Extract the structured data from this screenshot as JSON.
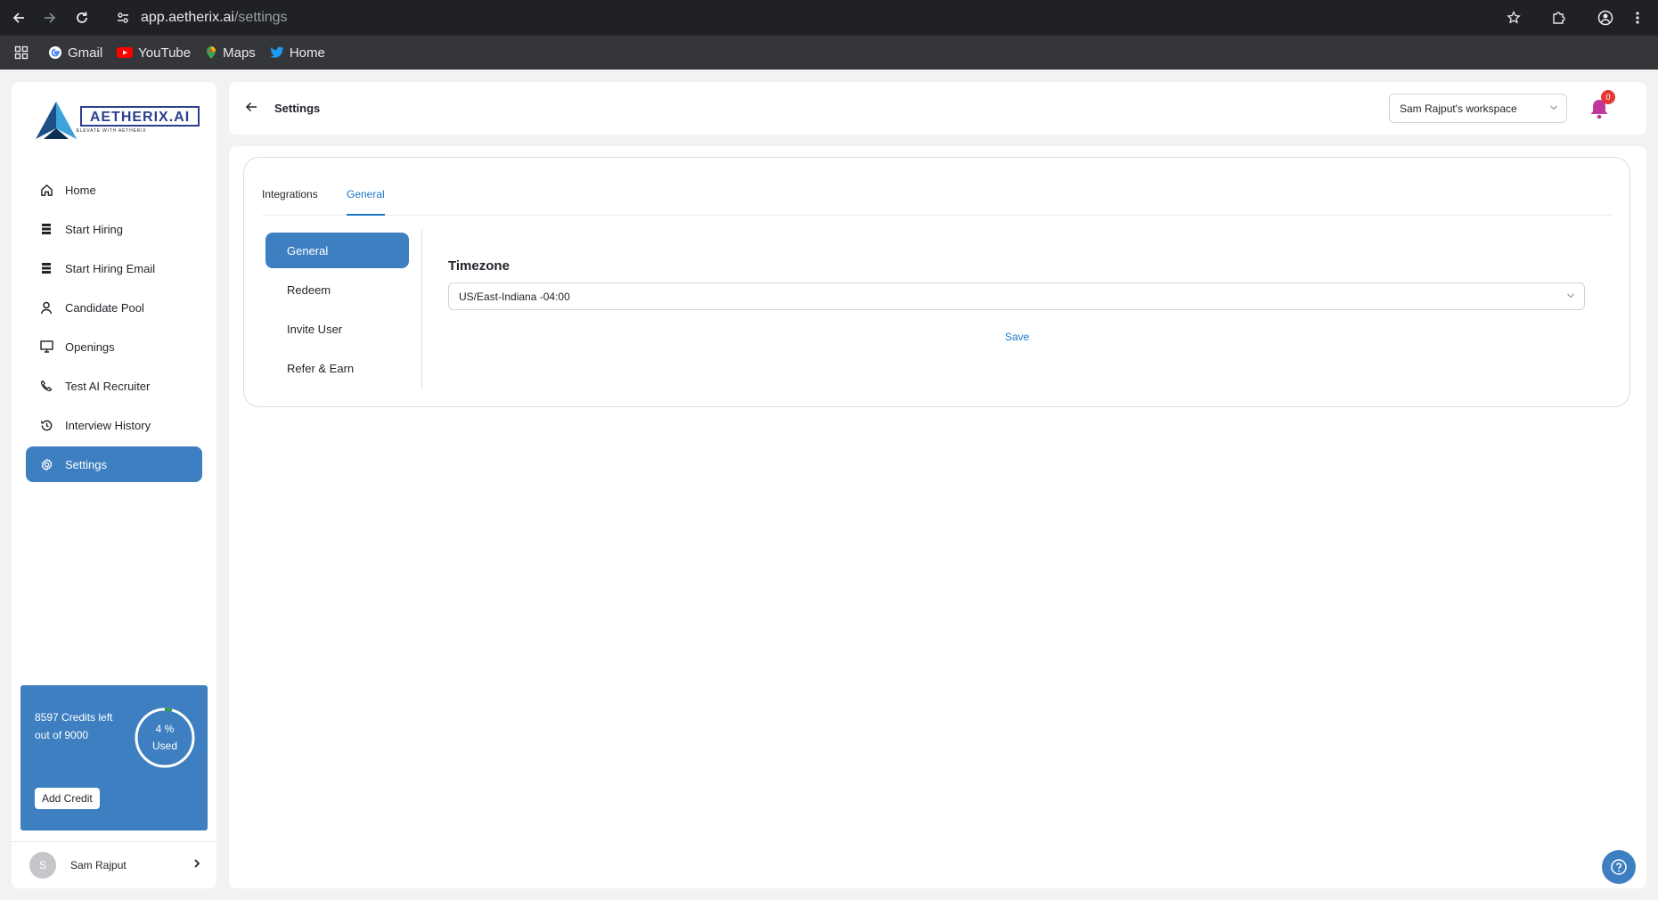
{
  "browser": {
    "url_host": "app.aetherix.ai",
    "url_path": "/settings",
    "bookmarks": [
      {
        "label": "Gmail",
        "icon": "google-icon"
      },
      {
        "label": "YouTube",
        "icon": "youtube-icon"
      },
      {
        "label": "Maps",
        "icon": "maps-icon"
      },
      {
        "label": "Home",
        "icon": "twitter-icon"
      }
    ]
  },
  "sidebar": {
    "logo_text": "AETHERIX.AI",
    "logo_tagline": "ELEVATE WITH AETHERIX",
    "items": [
      {
        "label": "Home",
        "icon": "home-icon"
      },
      {
        "label": "Start Hiring",
        "icon": "list-icon"
      },
      {
        "label": "Start Hiring Email",
        "icon": "list-icon"
      },
      {
        "label": "Candidate Pool",
        "icon": "person-icon"
      },
      {
        "label": "Openings",
        "icon": "monitor-icon"
      },
      {
        "label": "Test AI Recruiter",
        "icon": "phone-icon"
      },
      {
        "label": "Interview History",
        "icon": "history-icon"
      },
      {
        "label": "Settings",
        "icon": "gear-icon",
        "active": true
      }
    ],
    "credits": {
      "line1": "8597 Credits left",
      "line2": "out of 9000",
      "used_percent_label": "4 %",
      "used_label": "Used",
      "used_fraction": 0.04,
      "add_button": "Add Credit"
    },
    "user": {
      "initial": "S",
      "name": "Sam Rajput"
    }
  },
  "header": {
    "title": "Settings",
    "workspace": "Sam Rajput's workspace",
    "notification_count": "0"
  },
  "settings": {
    "tabs": [
      {
        "label": "Integrations",
        "active": false
      },
      {
        "label": "General",
        "active": true
      }
    ],
    "subnav": [
      {
        "label": "General",
        "active": true
      },
      {
        "label": "Redeem",
        "active": false
      },
      {
        "label": "Invite User",
        "active": false
      },
      {
        "label": "Refer & Earn",
        "active": false
      }
    ],
    "timezone_label": "Timezone",
    "timezone_value": "US/East-Indiana -04:00",
    "save_label": "Save"
  },
  "colors": {
    "accent": "#3d7fc1",
    "link": "#1c75c9",
    "badge": "#e53935",
    "notification_bell": "#c0399a",
    "ring_progress": "#2e9e3a"
  }
}
